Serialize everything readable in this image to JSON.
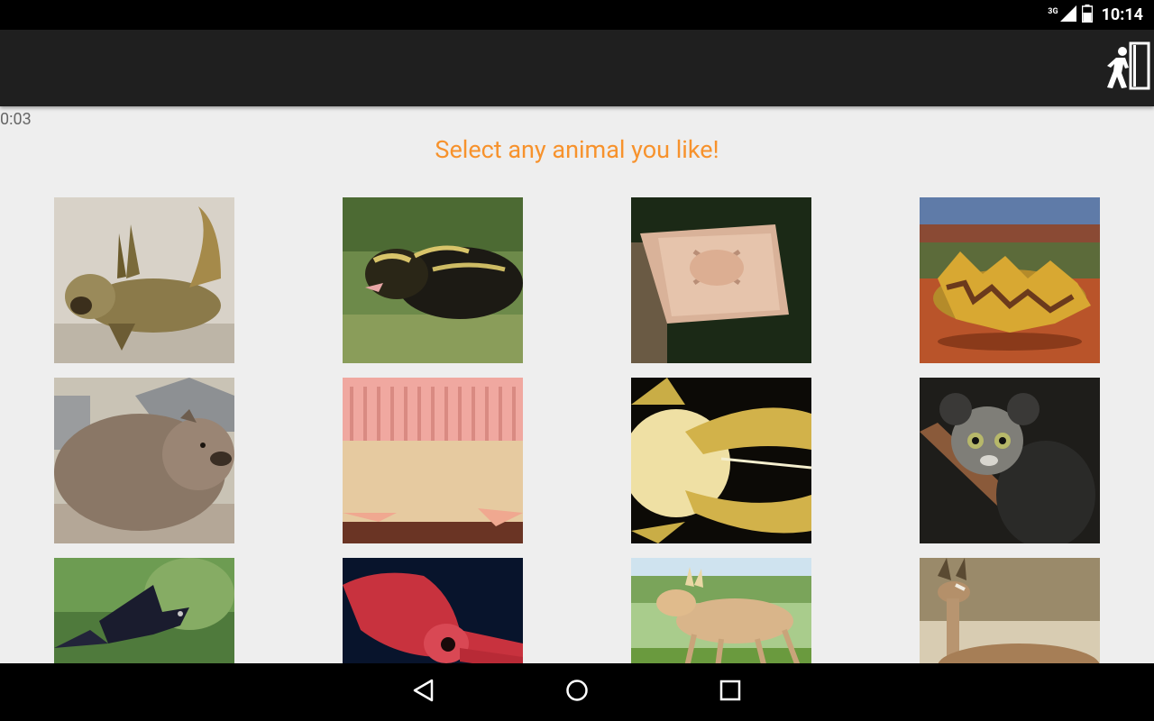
{
  "status_bar": {
    "network_type": "3G",
    "time": "10:14",
    "icons": [
      "signal-icon",
      "battery-icon"
    ]
  },
  "toolbar": {
    "exit_icon": "exit-door-icon"
  },
  "timer": "0:03",
  "title": "Select any animal you like!",
  "animals": [
    {
      "name": "mudskipper"
    },
    {
      "name": "tenrec"
    },
    {
      "name": "flying-squirrel"
    },
    {
      "name": "thorny-devil"
    },
    {
      "name": "wombat"
    },
    {
      "name": "armadillo"
    },
    {
      "name": "yeti-crab"
    },
    {
      "name": "aye-aye"
    },
    {
      "name": "drongo"
    },
    {
      "name": "squid"
    },
    {
      "name": "saiga"
    },
    {
      "name": "gerenuk"
    }
  ],
  "nav_bar": {
    "back_icon": "back-triangle-icon",
    "home_icon": "home-circle-icon",
    "recents_icon": "recents-square-icon"
  }
}
